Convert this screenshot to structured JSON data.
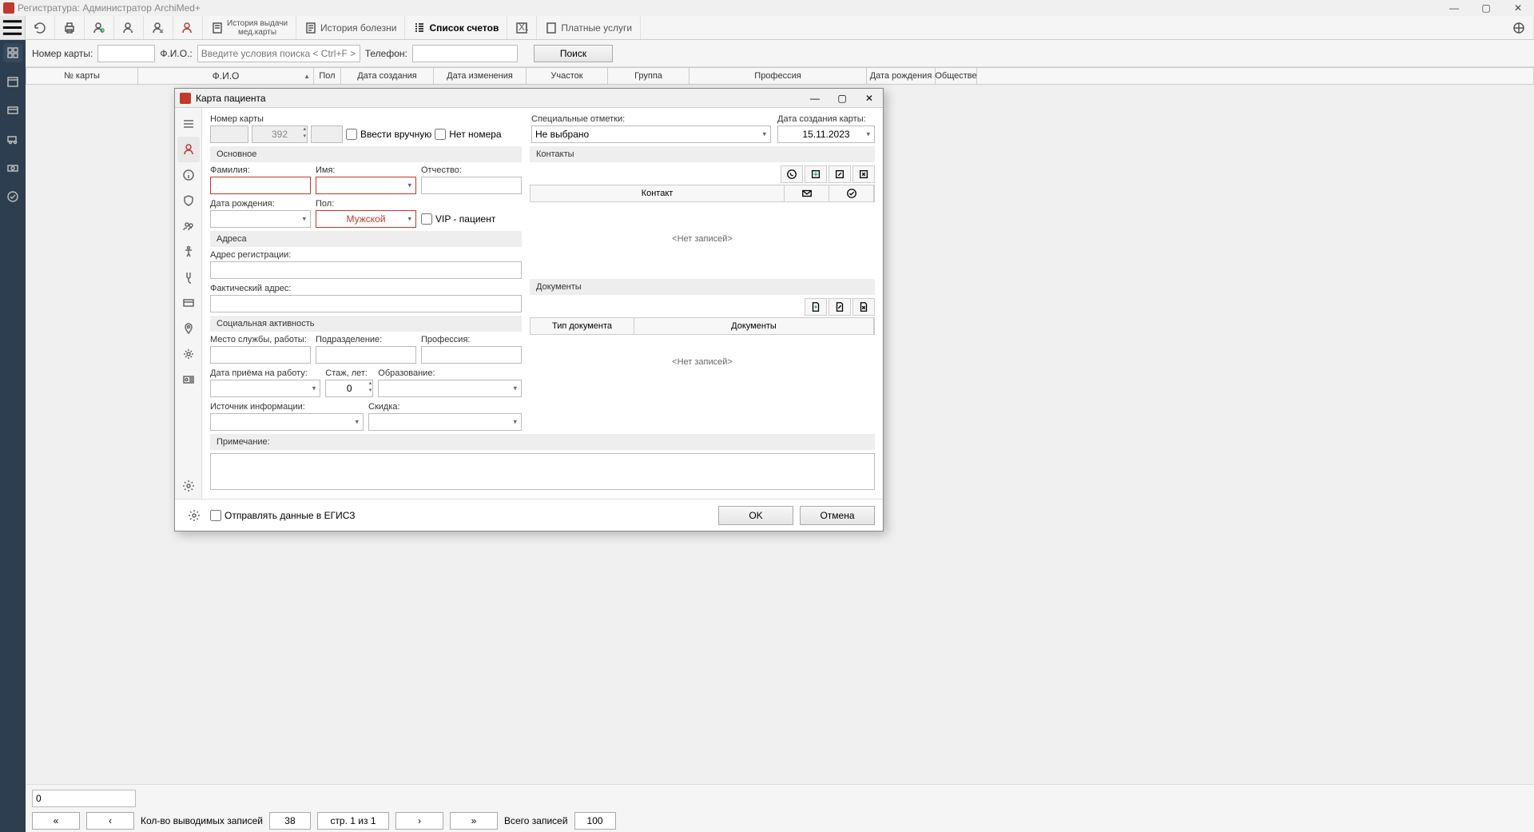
{
  "window": {
    "title": "Регистратура: Администратор ArchiMed+"
  },
  "toolbar": {
    "history_medcard": "История выдачи\nмед.карты",
    "history_disease": "История болезни",
    "invoice_list": "Список счетов",
    "paid_services": "Платные услуги"
  },
  "search": {
    "card_no_label": "Номер карты:",
    "fio_label": "Ф.И.О.:",
    "fio_placeholder": "Введите условия поиска < Ctrl+F >",
    "phone_label": "Телефон:",
    "search_btn": "Поиск"
  },
  "table_headers": [
    "№ карты",
    "Ф.И.О",
    "Пол",
    "Дата создания",
    "Дата изменения",
    "Участок",
    "Группа",
    "Профессия",
    "Дата рождения",
    "Обществе"
  ],
  "dialog": {
    "title": "Карта пациента",
    "card_no_label": "Номер карты",
    "card_no_value": "392",
    "manual_entry": "Ввести вручную",
    "no_number": "Нет номера",
    "special_marks_label": "Специальные отметки:",
    "special_marks_value": "Не выбрано",
    "creation_date_label": "Дата создания карты:",
    "creation_date_value": "15.11.2023",
    "section_main": "Основное",
    "section_contacts": "Контакты",
    "surname_label": "Фамилия:",
    "name_label": "Имя:",
    "patronymic_label": "Отчество:",
    "dob_label": "Дата рождения:",
    "gender_label": "Пол:",
    "gender_value": "Мужской",
    "vip_label": "VIP - пациент",
    "contact_col": "Контакт",
    "no_records": "<Нет записей>",
    "section_addresses": "Адреса",
    "reg_address_label": "Адрес регистрации:",
    "actual_address_label": "Фактический адрес:",
    "section_social": "Социальная активность",
    "section_documents": "Документы",
    "workplace_label": "Место службы, работы:",
    "department_label": "Подразделение:",
    "profession_label": "Профессия:",
    "doc_type_col": "Тип документа",
    "doc_col": "Документы",
    "hire_date_label": "Дата приёма на работу:",
    "experience_label": "Стаж, лет:",
    "experience_value": "0",
    "education_label": "Образование:",
    "info_source_label": "Источник информации:",
    "discount_label": "Скидка:",
    "notes_label": "Примечание:",
    "send_egisz": "Отправлять данные в ЕГИСЗ",
    "ok_btn": "OK",
    "cancel_btn": "Отмена"
  },
  "status": {
    "zero": "0",
    "records_out_label": "Кол-во выводимых записей",
    "records_out_value": "38",
    "page_info": "стр. 1 из 1",
    "total_label": "Всего записей",
    "total_value": "100"
  }
}
